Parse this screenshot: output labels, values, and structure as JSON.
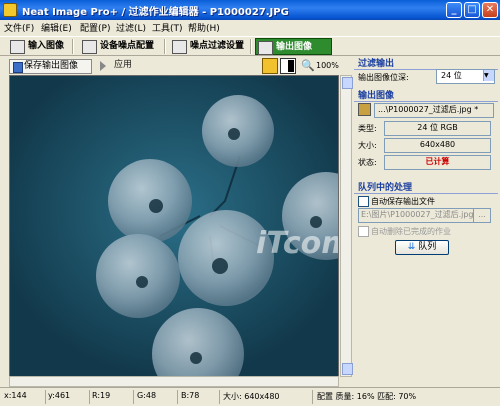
{
  "window": {
    "title": "Neat Image Pro+ / 过滤作业编辑器 - P1000027.JPG",
    "minimize_glyph": "_",
    "maximize_glyph": "□",
    "close_glyph": "✕"
  },
  "menu": [
    "文件(F)",
    "编辑(E)",
    "配置(P)",
    "过滤(L)",
    "工具(T)",
    "帮助(H)"
  ],
  "tabs": [
    {
      "label": "输入图像",
      "icon": "input-image-icon"
    },
    {
      "label": "设备噪点配置",
      "icon": "device-noise-icon"
    },
    {
      "label": "噪点过滤设置",
      "icon": "filter-settings-icon"
    },
    {
      "label": "输出图像",
      "icon": "output-image-icon",
      "active": true
    }
  ],
  "toolbar": {
    "save_label": "保存输出图像",
    "apply_label": "应用",
    "zoom_level": "100%"
  },
  "right_panel": {
    "filter_output": {
      "heading": "过滤输出",
      "bit_depth_label": "输出图像位深:",
      "bit_depth_value": "24 位"
    },
    "output_image": {
      "heading": "输出图像",
      "filename": "...\\P1000027_过滤后.jpg *",
      "type_label": "类型:",
      "type_value": "24 位 RGB",
      "size_label": "大小:",
      "size_value": "640x480",
      "status_label": "状态:",
      "status_value": "已计算"
    },
    "queue": {
      "heading": "队列中的处理",
      "auto_save_label": "自动保存输出文件",
      "path_value": "E:\\图片\\P1000027_过滤后.jpg",
      "browse_label": "...",
      "auto_delete_label": "自动删除已完成的作业",
      "queue_button_label": "队列"
    }
  },
  "statusbar": {
    "x": "x:144",
    "y": "y:461",
    "r": "R:19",
    "g": "G:48",
    "b": "B:78",
    "size": "大小: 640x480",
    "profile": "配置 质量: 16% 匹配: 70%"
  },
  "colors": {
    "title_bar": "#0a5fd8",
    "active_tab": "#2e8b2e",
    "image_background": "#16465b",
    "status_computed": "#cc0000",
    "section_heading": "#1b3fa0"
  },
  "watermark": "iTcom.cn"
}
